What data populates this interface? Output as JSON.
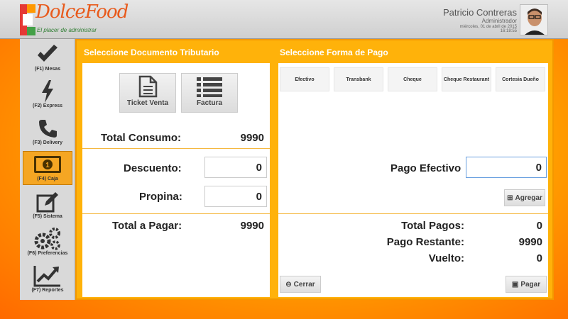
{
  "header": {
    "logo": "DolceFood",
    "tagline": "El placer de administrar",
    "user_name": "Patricio Contreras",
    "user_role": "Administrador",
    "date": "miércoles, 01 de abril de 2015",
    "time": "16:18:55"
  },
  "sidebar": {
    "items": [
      {
        "label": "(F1) Mesas",
        "icon": "check-icon"
      },
      {
        "label": "(F2) Express",
        "icon": "lightning-icon"
      },
      {
        "label": "(F3) Delivery",
        "icon": "phone-icon"
      },
      {
        "label": "(F4) Caja",
        "icon": "cash-icon",
        "active": true
      },
      {
        "label": "(F5) Sistema",
        "icon": "edit-icon"
      },
      {
        "label": "(F6) Preferencias",
        "icon": "gears-icon"
      },
      {
        "label": "(F7) Reportes",
        "icon": "chart-icon"
      }
    ]
  },
  "document_panel": {
    "title": "Seleccione Documento Tributario",
    "ticket_label": "Ticket Venta",
    "invoice_label": "Factura",
    "total_consumo_label": "Total Consumo:",
    "total_consumo_value": "9990",
    "descuento_label": "Descuento:",
    "descuento_value": "0",
    "propina_label": "Propina:",
    "propina_value": "0",
    "total_pagar_label": "Total a Pagar:",
    "total_pagar_value": "9990"
  },
  "payment_panel": {
    "title": "Seleccione Forma de Pago",
    "tabs": [
      "Efectivo",
      "Transbank",
      "Cheque",
      "Cheque Restaurant",
      "Cortesia Dueño"
    ],
    "pago_efectivo_label": "Pago Efectivo",
    "pago_efectivo_value": "0",
    "agregar_label": "Agregar",
    "total_pagos_label": "Total Pagos:",
    "total_pagos_value": "0",
    "pago_restante_label": "Pago Restante:",
    "pago_restante_value": "9990",
    "vuelto_label": "Vuelto:",
    "vuelto_value": "0",
    "cerrar_label": "Cerrar",
    "pagar_label": "Pagar"
  },
  "colors": {
    "accent": "#ffb20a",
    "active_nav": "#f5a623",
    "logo": "#e85a1c"
  }
}
